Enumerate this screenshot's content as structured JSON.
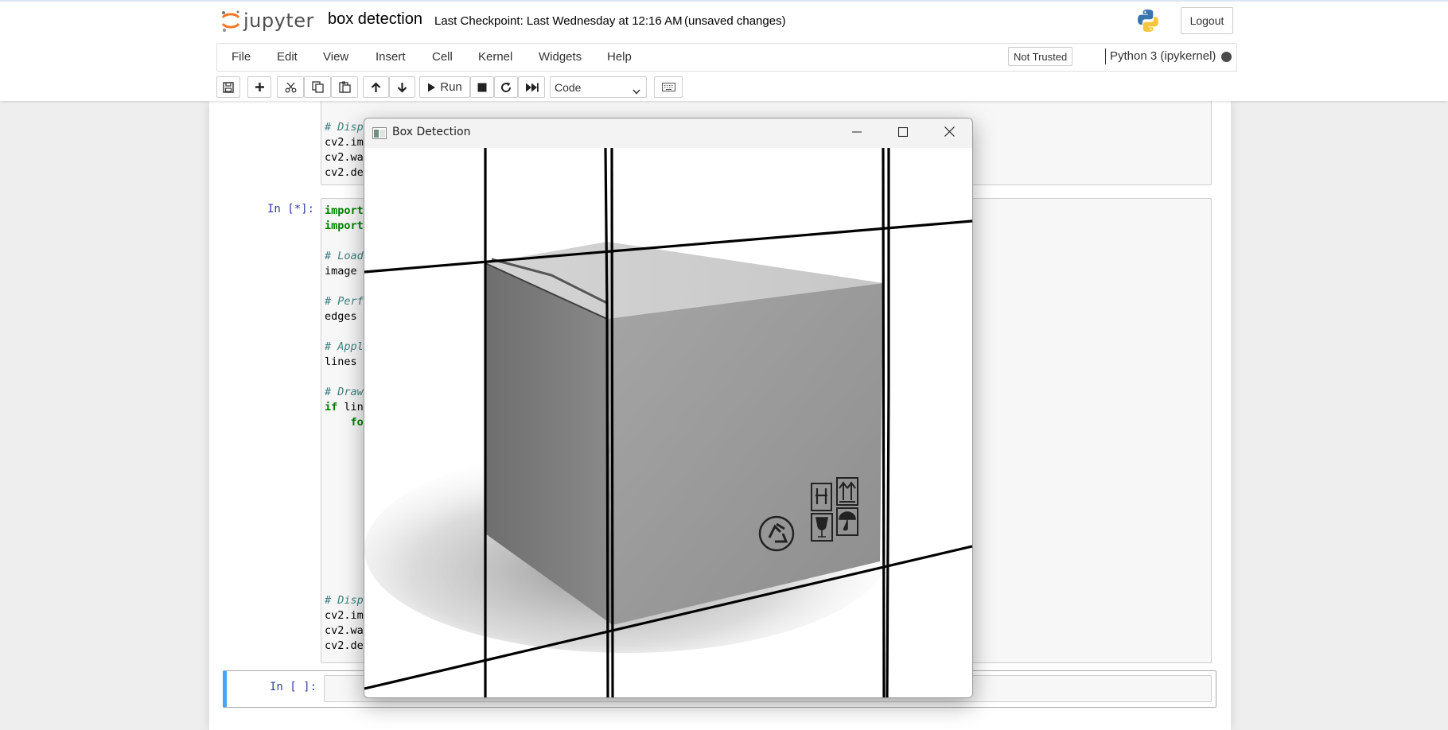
{
  "header": {
    "logo_text": "jupyter",
    "notebook_title": "box detection",
    "checkpoint": "Last Checkpoint: Last Wednesday at 12:16 AM",
    "unsaved": "(unsaved changes)",
    "logout_label": "Logout"
  },
  "menubar": {
    "items": [
      "File",
      "Edit",
      "View",
      "Insert",
      "Cell",
      "Kernel",
      "Widgets",
      "Help"
    ],
    "trust_status": "Not Trusted",
    "kernel_name": "Python 3 (ipykernel)"
  },
  "toolbar": {
    "run_label": "Run",
    "cell_type": "Code",
    "icons": [
      "save-icon",
      "plus-icon",
      "cut-icon",
      "copy-icon",
      "paste-icon",
      "arrow-up-icon",
      "arrow-down-icon",
      "play-icon",
      "stop-icon",
      "restart-icon",
      "fast-forward-icon",
      "keyboard-icon"
    ]
  },
  "cells": [
    {
      "prompt": "",
      "lines": [
        {
          "text": "# Disp",
          "type": "comment"
        },
        {
          "text": "cv2.im",
          "type": "code"
        },
        {
          "text": "cv2.wa",
          "type": "code"
        },
        {
          "text": "cv2.de",
          "type": "code"
        }
      ]
    },
    {
      "prompt": "In [*]:",
      "lines": [
        {
          "text": "import",
          "type": "keyword"
        },
        {
          "text": "import",
          "type": "keyword"
        },
        {
          "text": "",
          "type": "blank"
        },
        {
          "text": "# Load",
          "type": "comment"
        },
        {
          "text": "image ",
          "type": "code"
        },
        {
          "text": "",
          "type": "blank"
        },
        {
          "text": "# Perf",
          "type": "comment"
        },
        {
          "text": "edges ",
          "type": "code"
        },
        {
          "text": "",
          "type": "blank"
        },
        {
          "text": "# Appl",
          "type": "comment"
        },
        {
          "text": "lines ",
          "type": "code"
        },
        {
          "text": "",
          "type": "blank"
        },
        {
          "text": "# Draw",
          "type": "comment"
        },
        {
          "text": "if lin",
          "type": "mixed"
        },
        {
          "text": "    fo",
          "type": "keyword-indent"
        }
      ],
      "tail_lines": [
        {
          "text": "# Disp",
          "type": "comment"
        },
        {
          "text": "cv2.im",
          "type": "code"
        },
        {
          "text": "cv2.wa",
          "type": "code"
        },
        {
          "text": "cv2.de",
          "type": "code"
        }
      ]
    },
    {
      "prompt": "In [ ]:",
      "lines": []
    }
  ],
  "popup": {
    "title": "Box Detection",
    "icons": [
      "app-window-icon",
      "minimize-icon",
      "maximize-icon",
      "close-icon"
    ],
    "box_icons": [
      "recycle-icon",
      "keep-away-icon",
      "this-side-up-icon",
      "fragile-icon",
      "keep-dry-icon"
    ]
  }
}
